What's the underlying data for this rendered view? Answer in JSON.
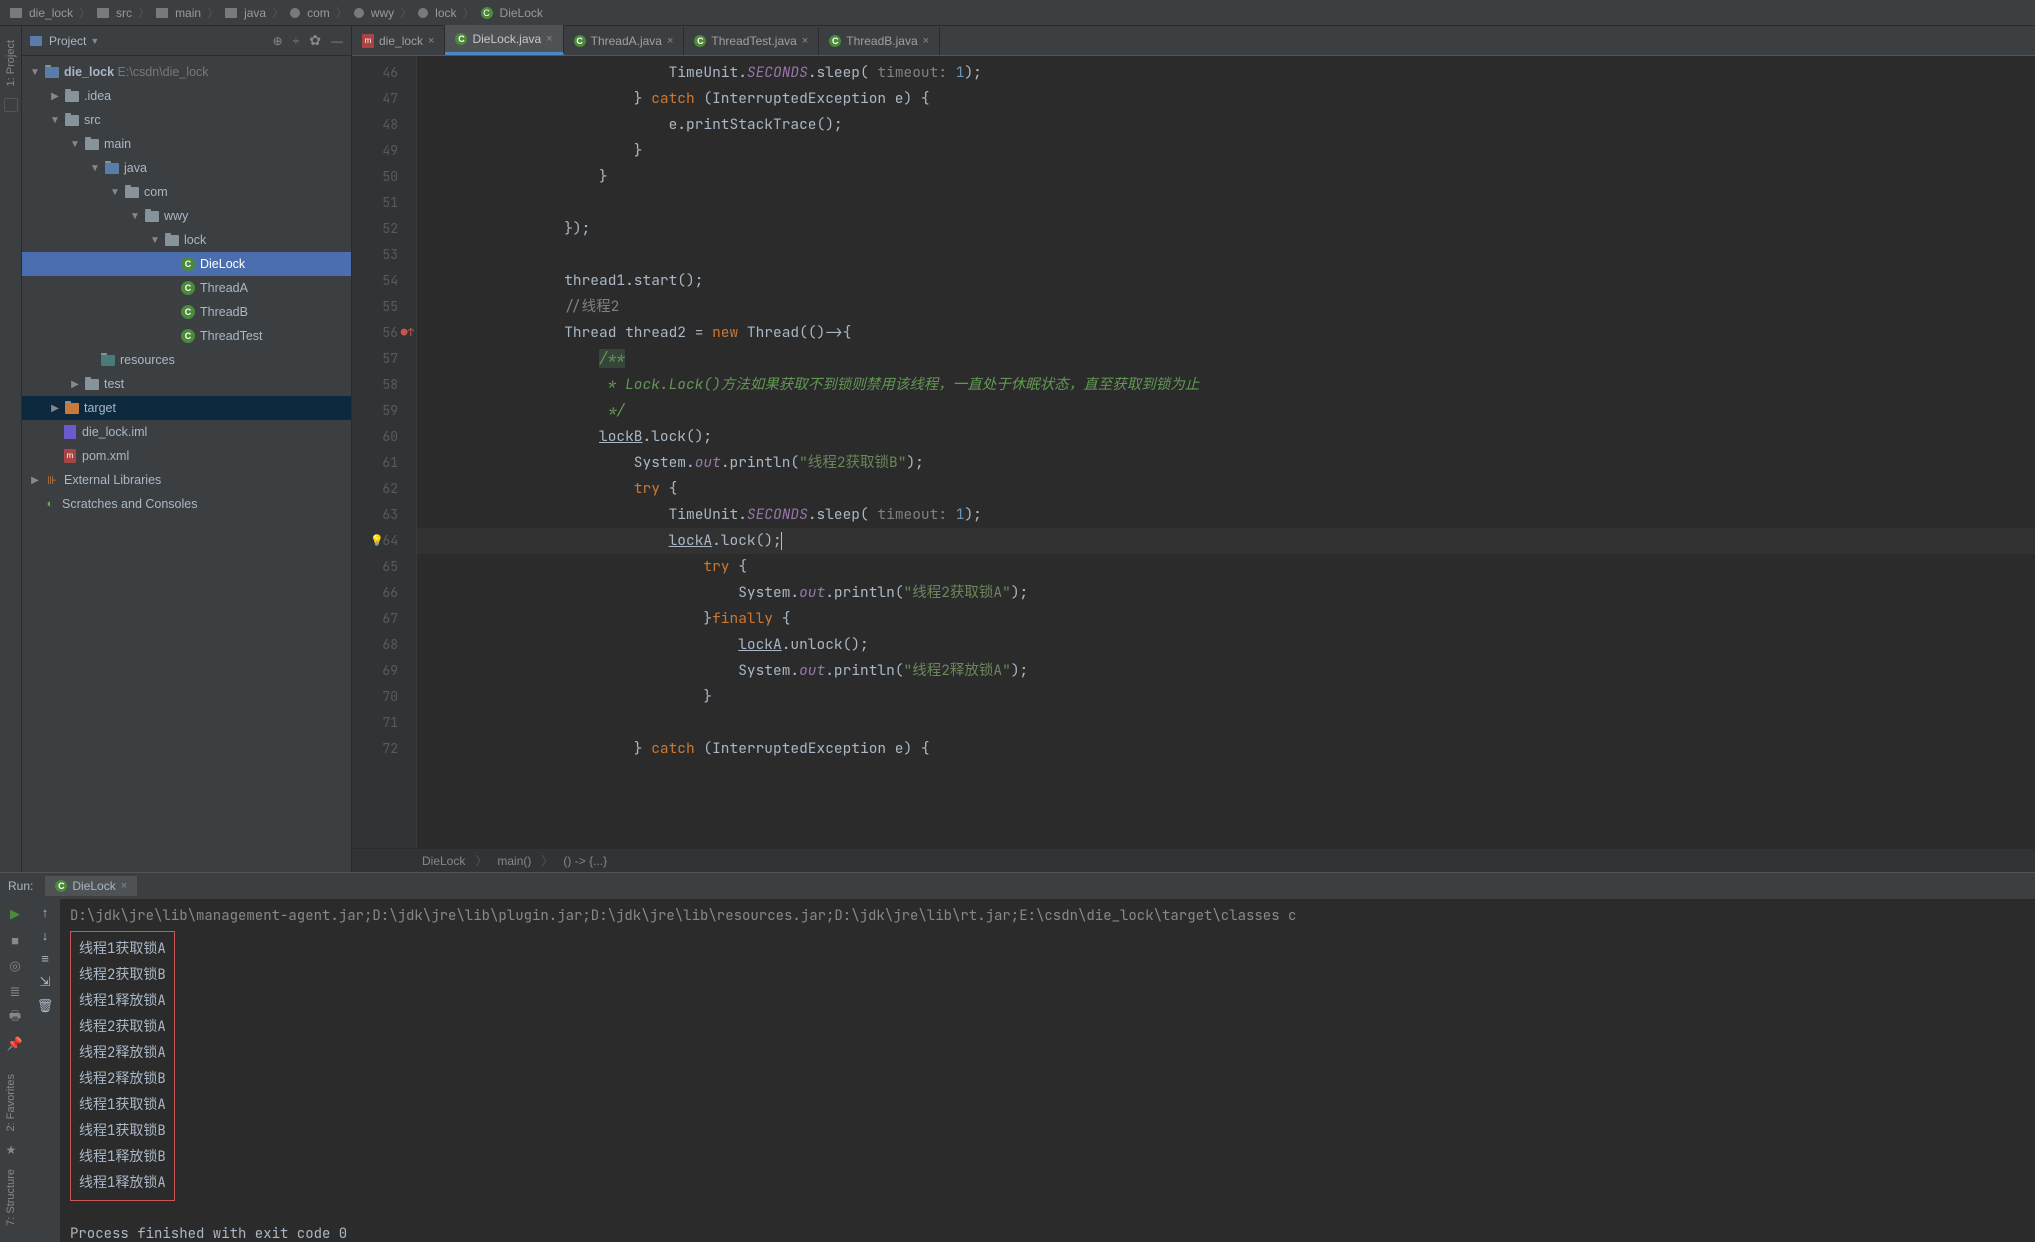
{
  "breadcrumbs": [
    "die_lock",
    "src",
    "main",
    "java",
    "com",
    "wwy",
    "lock",
    "DieLock"
  ],
  "project_header": {
    "title": "Project"
  },
  "tree": {
    "root": {
      "name": "die_lock",
      "path": "E:\\csdn\\die_lock"
    },
    "idea": ".idea",
    "src": "src",
    "main": "main",
    "java": "java",
    "com": "com",
    "wwy": "wwy",
    "lock": "lock",
    "classes": [
      "DieLock",
      "ThreadA",
      "ThreadB",
      "ThreadTest"
    ],
    "resources": "resources",
    "test": "test",
    "target": "target",
    "iml": "die_lock.iml",
    "pom": "pom.xml",
    "ext": "External Libraries",
    "scratch": "Scratches and Consoles"
  },
  "tabs": [
    {
      "label": "die_lock",
      "type": "m"
    },
    {
      "label": "DieLock.java",
      "type": "c",
      "active": true
    },
    {
      "label": "ThreadA.java",
      "type": "c"
    },
    {
      "label": "ThreadTest.java",
      "type": "c"
    },
    {
      "label": "ThreadB.java",
      "type": "c"
    }
  ],
  "editor": {
    "startLine": 46,
    "lines": [
      {
        "n": 46,
        "html": "                            TimeUnit.<span class='st'>SECONDS</span>.sleep( <span class='param'>timeout:</span> <span class='lit'>1</span>);"
      },
      {
        "n": 47,
        "html": "                        } <span class='kw'>catch</span> (InterruptedException e) {"
      },
      {
        "n": 48,
        "html": "                            e.printStackTrace();"
      },
      {
        "n": 49,
        "html": "                        }"
      },
      {
        "n": 50,
        "html": "                    }"
      },
      {
        "n": 51,
        "html": ""
      },
      {
        "n": 52,
        "html": "                });"
      },
      {
        "n": 53,
        "html": ""
      },
      {
        "n": 54,
        "html": "                thread1.start();"
      },
      {
        "n": 55,
        "html": "                <span class='cm2'>//线程2</span>"
      },
      {
        "n": 56,
        "html": "                Thread thread2 = <span class='kw'>new</span> Thread(()->{",
        "mark": "●↑"
      },
      {
        "n": 57,
        "html": "                    <span class='doc doc-hl'>/**</span>"
      },
      {
        "n": 58,
        "html": "                    <span class='doc'> * Lock.Lock()方法如果获取不到锁则禁用该线程，一直处于休眠状态，直至获取到锁为止</span>"
      },
      {
        "n": 59,
        "html": "                    <span class='doc'> */</span>"
      },
      {
        "n": 60,
        "html": "                    <span class='und'>lockB</span>.lock();"
      },
      {
        "n": 61,
        "html": "                        System.<span class='st'>out</span>.println(<span class='str'>\"线程2获取锁B\"</span>);"
      },
      {
        "n": 62,
        "html": "                        <span class='kw'>try</span> {"
      },
      {
        "n": 63,
        "html": "                            TimeUnit.<span class='st'>SECONDS</span>.sleep( <span class='param'>timeout:</span> <span class='lit'>1</span>);"
      },
      {
        "n": 64,
        "html": "                            <span class='und'>lockA</span>.lock();<span class='caret'></span>",
        "hl": true,
        "bulb": true
      },
      {
        "n": 65,
        "html": "                                <span class='kw'>try</span> {"
      },
      {
        "n": 66,
        "html": "                                    System.<span class='st'>out</span>.println(<span class='str'>\"线程2获取锁A\"</span>);"
      },
      {
        "n": 67,
        "html": "                                }<span class='kw'>finally</span> {"
      },
      {
        "n": 68,
        "html": "                                    <span class='und'>lockA</span>.unlock();"
      },
      {
        "n": 69,
        "html": "                                    System.<span class='st'>out</span>.println(<span class='str'>\"线程2释放锁A\"</span>);"
      },
      {
        "n": 70,
        "html": "                                }"
      },
      {
        "n": 71,
        "html": ""
      },
      {
        "n": 72,
        "html": "                        } <span class='kw'>catch</span> (InterruptedException e) {"
      }
    ]
  },
  "nav_trail": [
    "DieLock",
    "main()",
    "() -> {...}"
  ],
  "run": {
    "label": "Run:",
    "tab": "DieLock",
    "path": "D:\\jdk\\jre\\lib\\management-agent.jar;D:\\jdk\\jre\\lib\\plugin.jar;D:\\jdk\\jre\\lib\\resources.jar;D:\\jdk\\jre\\lib\\rt.jar;E:\\csdn\\die_lock\\target\\classes c",
    "output": [
      "线程1获取锁A",
      "线程2获取锁B",
      "线程1释放锁A",
      "线程2获取锁A",
      "线程2释放锁A",
      "线程2释放锁B",
      "线程1获取锁A",
      "线程1获取锁B",
      "线程1释放锁B",
      "线程1释放锁A"
    ],
    "exit": "Process finished with exit code 0"
  },
  "left_labels": {
    "proj": "1: Project",
    "fav": "2: Favorites",
    "struct": "7: Structure"
  }
}
